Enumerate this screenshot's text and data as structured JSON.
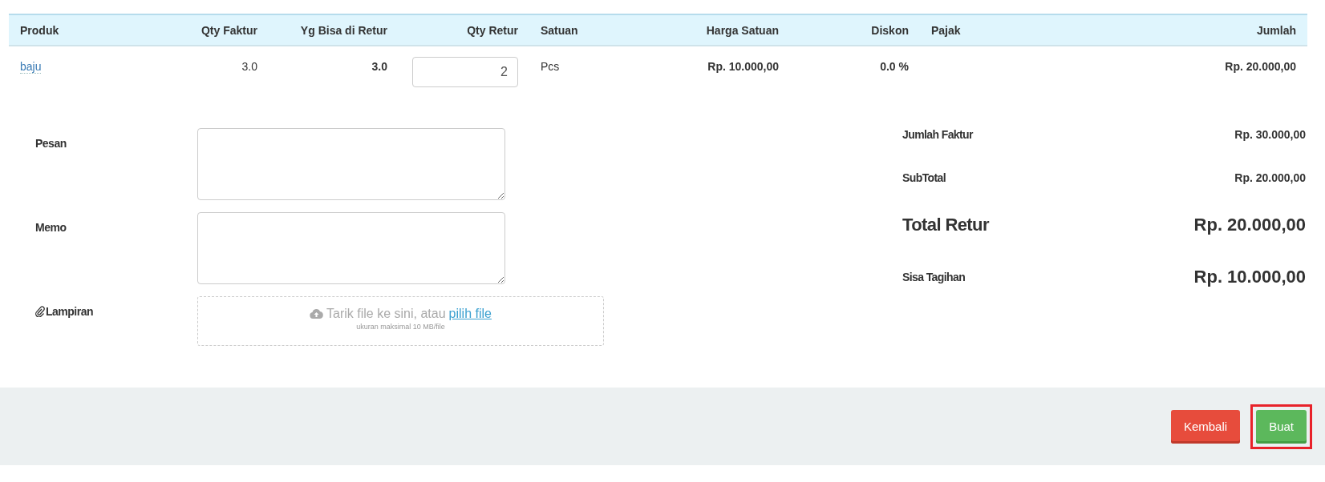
{
  "table": {
    "columns": [
      "Produk",
      "Qty Faktur",
      "Yg Bisa di Retur",
      "Qty Retur",
      "Satuan",
      "Harga Satuan",
      "Diskon",
      "Pajak",
      "Jumlah"
    ],
    "rows": [
      {
        "product": "baju",
        "qty_faktur": "3.0",
        "returnable": "3.0",
        "qty_retur": "2",
        "unit": "Pcs",
        "unit_price": "Rp. 10.000,00",
        "discount": "0.0 %",
        "amount": "Rp. 20.000,00"
      }
    ]
  },
  "form": {
    "fields": [
      {
        "kind": "textarea",
        "label": "Pesan"
      },
      {
        "kind": "textarea",
        "label": "Memo"
      },
      {
        "kind": "upload",
        "label": "Lampiran",
        "drop_text": "Tarik file ke sini, atau",
        "link": "pilih file",
        "hint": "ukuran maksimal 10 MB/file"
      }
    ]
  },
  "summary": [
    {
      "kind": "normal",
      "label": "Jumlah Faktur",
      "value": "Rp. 30.000,00"
    },
    {
      "kind": "normal",
      "label": "SubTotal",
      "value": "Rp. 20.000,00"
    },
    {
      "kind": "total",
      "label": "Total Retur",
      "value": "Rp. 20.000,00"
    },
    {
      "kind": "due",
      "label": "Sisa Tagihan",
      "value": "Rp. 10.000,00"
    }
  ],
  "buttons": [
    {
      "kind": "danger",
      "label": "Kembali",
      "highlighted": false
    },
    {
      "kind": "success",
      "label": "Buat",
      "highlighted": true
    }
  ]
}
